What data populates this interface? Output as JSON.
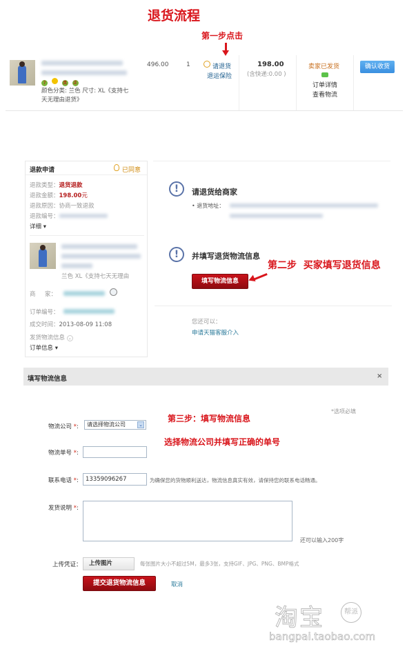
{
  "page_title": "退货流程",
  "step1": {
    "annotation": "第一步点击",
    "order": {
      "thumbnail": "product-photo",
      "title_blurred": true,
      "badges": [
        "7",
        "●",
        "真",
        "正"
      ],
      "spec": "颜色分类: 兰色  尺寸: XL《支持七天无理由退货》",
      "unit_price": "496.00",
      "quantity": "1",
      "refund_link": "请退货",
      "insurance_link": "退运保险",
      "total": "198.00",
      "shipping_note": "(含快递:0.00 )",
      "status": "卖家已发货",
      "detail_link": "订单详情",
      "logistics_link": "查看物流",
      "confirm_button": "确认收货"
    }
  },
  "step2": {
    "annotation": "第二步  买家填写退货信息",
    "panel": {
      "title": "退款申请",
      "status": "已同意",
      "rows": [
        {
          "label": "退款类型：",
          "value": "退货退款"
        },
        {
          "label": "退款金额：",
          "value": "198.00",
          "suffix": "元"
        },
        {
          "label": "退款原因：",
          "value": "协商一致退款"
        },
        {
          "label": "退款编号：",
          "value": ""
        }
      ],
      "detail_toggle": "详细",
      "product_spec": "兰色   XL《支持七天无理由",
      "seller_label": "商     家：",
      "order_no_label": "订单编号：",
      "deal_time_label": "成交时间：",
      "deal_time": "2013-08-09 11:08",
      "ship_info_toggle": "发货物流信息",
      "order_info_toggle": "订单信息"
    },
    "main": {
      "heading1": "请退货给商家",
      "address_label": "• 退货地址：",
      "heading2": "并填写退货物流信息",
      "fill_button": "填写物流信息",
      "also_label": "您还可以：",
      "service_link": "申请天猫客服介入"
    }
  },
  "step3": {
    "dialog_title": "填写物流信息",
    "close": "×",
    "required_note": "*选项必填",
    "annotation1": "第三步：填写物流信息",
    "annotation2": "选择物流公司并填写正确的单号",
    "fields": {
      "company_label": "物流公司",
      "company_value": "请选择物流公司",
      "tracking_label": "物流单号",
      "tracking_value": "",
      "phone_label": "联系电话",
      "phone_value": "13359096267",
      "phone_hint": "为确保您的货物顺利送达，物流信息真实有效，请保持您的联系电话畅通。",
      "note_label": "发货说明",
      "note_counter": "还可以输入200字",
      "upload_label": "上传凭证：",
      "upload_button": "上传图片",
      "upload_hint": "每张图片大小不超过5M，最多3张，支持GIF、JPG、PNG、BMP格式"
    },
    "submit_button": "提交退货物流信息",
    "cancel_link": "取消"
  },
  "watermark": {
    "logo_text": "淘宝",
    "badge": "帮派",
    "url": "bangpai.taobao.com"
  }
}
